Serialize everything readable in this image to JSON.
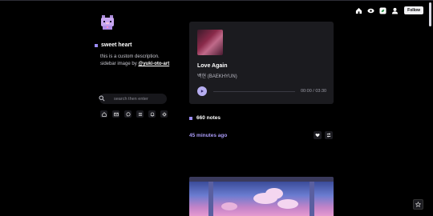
{
  "topbar": {
    "icons": [
      "home-icon",
      "eye-icon",
      "leaf-icon",
      "user-icon"
    ],
    "follow_label": "Follow"
  },
  "sidebar": {
    "title": "sweet heart",
    "description": "this is a custom description. sidebar image by ",
    "description_link": "@yuki-oto-art",
    "search_placeholder": "search then enter",
    "icons": [
      "home-icon",
      "message-icon",
      "chat-icon",
      "menu-icon",
      "bell-icon",
      "gear-icon"
    ]
  },
  "post": {
    "audio": {
      "title": "Love Again",
      "artist": "백현 (BAEKHYUN)",
      "time": "00:00 / 03:30",
      "progress": 0
    },
    "notes": "660 notes",
    "timestamp": "45 minutes ago"
  },
  "colors": {
    "background": "#000000",
    "accent": "#9b8cf5",
    "card": "#1b1b1f"
  }
}
